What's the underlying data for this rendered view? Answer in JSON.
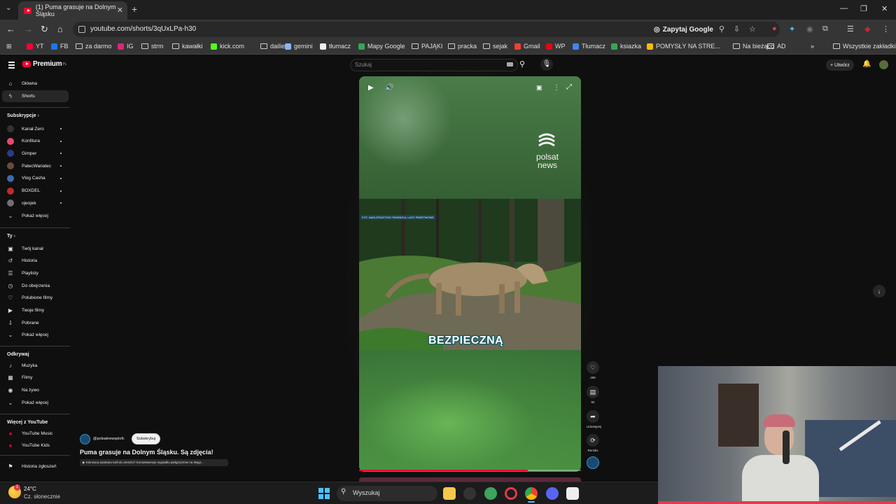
{
  "browser": {
    "tab_title": "(1) Puma grasuje na Dolnym Śląsku",
    "url": "youtube.com/shorts/3qUxLPa-h30",
    "zapytaj_label": "Zapytaj Google",
    "bookmarks": [
      {
        "label": "YT",
        "color": "#ff0033"
      },
      {
        "label": "FB",
        "color": "#1877f2"
      },
      {
        "label": "za darmo",
        "color": "folder"
      },
      {
        "label": "IG",
        "color": "#d62976"
      },
      {
        "label": "strm",
        "color": "folder"
      },
      {
        "label": "kawałki",
        "color": "folder"
      },
      {
        "label": "kick.com",
        "color": "#53fc18"
      },
      {
        "label": "dailies",
        "color": "folder"
      },
      {
        "label": "gemini",
        "color": "#8ab4f8"
      },
      {
        "label": "tłumacz",
        "color": "#eeeeee"
      },
      {
        "label": "Mapy Google",
        "color": "#34a853"
      },
      {
        "label": "PAJĄKI",
        "color": "folder"
      },
      {
        "label": "pracka",
        "color": "folder"
      },
      {
        "label": "sejak",
        "color": "folder"
      },
      {
        "label": "Gmail",
        "color": "#ea4335"
      },
      {
        "label": "WP",
        "color": "#e30613"
      },
      {
        "label": "Tłumacz",
        "color": "#4285f4"
      },
      {
        "label": "ksiazka",
        "color": "#34a853"
      },
      {
        "label": "POMYSŁY NA STRE...",
        "color": "#fbbc04"
      },
      {
        "label": "Na bieżąco",
        "color": "folder"
      },
      {
        "label": "AD",
        "color": "folder"
      }
    ],
    "all_bookmarks_label": "Wszystkie zakładki"
  },
  "youtube": {
    "logo_text": "Premium",
    "logo_sup": "PL",
    "search_placeholder": "Szukaj",
    "create_label": "+ Utwórz",
    "sidebar": {
      "main": [
        {
          "label": "Główna",
          "icon": "home-icon"
        },
        {
          "label": "Shorts",
          "icon": "shorts-icon"
        }
      ],
      "subs_heading": "Subskrypcje",
      "subs": [
        {
          "label": "Kanał Zero",
          "color": "#333333"
        },
        {
          "label": "Konfitura",
          "color": "#e84a6b"
        },
        {
          "label": "Gimper",
          "color": "#2b3b8a"
        },
        {
          "label": "PatecWariatec",
          "color": "#6b4b3a"
        },
        {
          "label": "Vlog Casha",
          "color": "#3a6bb0"
        },
        {
          "label": "BOXDEL",
          "color": "#c22a2a"
        },
        {
          "label": "ojeojek",
          "color": "#707070"
        }
      ],
      "subs_more": "Pokaż więcej",
      "you_heading": "Ty",
      "you": [
        {
          "label": "Twój kanał",
          "icon": "channel-icon"
        },
        {
          "label": "Historia",
          "icon": "history-icon"
        },
        {
          "label": "Playlisty",
          "icon": "playlist-icon"
        },
        {
          "label": "Do obejrzenia",
          "icon": "clock-icon"
        },
        {
          "label": "Polubione filmy",
          "icon": "like-icon"
        },
        {
          "label": "Twoje filmy",
          "icon": "video-icon"
        },
        {
          "label": "Pobrane",
          "icon": "download-icon"
        },
        {
          "label": "Pokaż więcej",
          "icon": "chevron-down-icon"
        }
      ],
      "explore_heading": "Odkrywaj",
      "explore": [
        {
          "label": "Muzyka",
          "icon": "music-icon"
        },
        {
          "label": "Filmy",
          "icon": "film-icon"
        },
        {
          "label": "Na żywo",
          "icon": "live-icon"
        },
        {
          "label": "Pokaż więcej",
          "icon": "chevron-down-icon"
        }
      ],
      "more_heading": "Więcej z YouTube",
      "more": [
        {
          "label": "YouTube Music",
          "icon": "yt-music-icon"
        },
        {
          "label": "YouTube Kids",
          "icon": "yt-kids-icon"
        }
      ],
      "report": "Historia zgłoszeń"
    },
    "short": {
      "watermark": "polsat news",
      "scene_label": "FOT: NADLEŚNICTWO ŚWIDNICA, LASY PAŃSTWOWE",
      "caption": "BEZPIECZNĄ",
      "channel": "@polsatnewsplofc",
      "subscribe_label": "Subskrybuj",
      "title": "Puma grasuje na Dolnym Śląsku. Są zdjęcia!",
      "related_link": "▶ Kierowca autokaru trafi do aresztu? Konsekwencje wypadku pielgrzymów na Węgr...",
      "progress": 0.76,
      "actions": [
        {
          "icon": "like-icon",
          "label": "289"
        },
        {
          "icon": "comment-icon",
          "label": "82"
        },
        {
          "icon": "share-icon",
          "label": "Udostępnij"
        },
        {
          "icon": "remix-icon",
          "label": "Remiks"
        }
      ]
    }
  },
  "taskbar": {
    "temperature": "24°C",
    "weather": "Cz. słonecznie",
    "weather_badge": "1",
    "search_label": "Wyszukaj"
  }
}
